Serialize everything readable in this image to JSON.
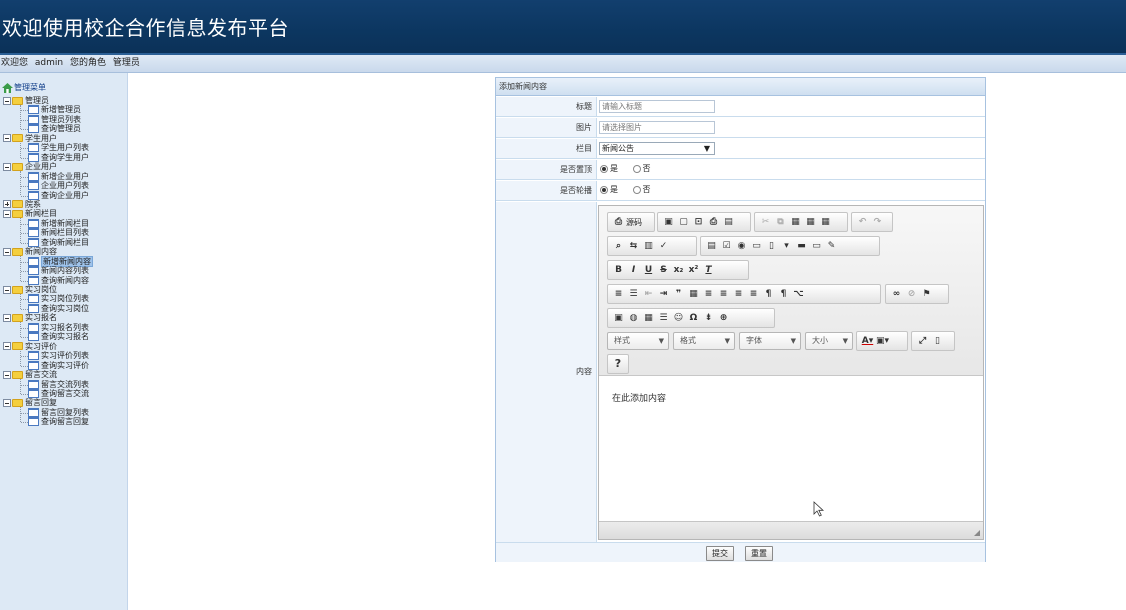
{
  "header": {
    "title": "欢迎使用校企合作信息发布平台"
  },
  "userbar": {
    "welcome": "欢迎您",
    "username": "admin",
    "role_label": "您的角色",
    "role": "管理员"
  },
  "sidebar": {
    "root": "管理菜单",
    "groups": [
      {
        "label": "管理员",
        "items": [
          "新增管理员",
          "管理员列表",
          "查询管理员"
        ]
      },
      {
        "label": "学生用户",
        "items": [
          "学生用户列表",
          "查询学生用户"
        ]
      },
      {
        "label": "企业用户",
        "items": [
          "新增企业用户",
          "企业用户列表",
          "查询企业用户"
        ]
      },
      {
        "label": "院系",
        "items": []
      },
      {
        "label": "新闻栏目",
        "items": [
          "新增新闻栏目",
          "新闻栏目列表",
          "查询新闻栏目"
        ]
      },
      {
        "label": "新闻内容",
        "items": [
          "新增新闻内容",
          "新闻内容列表",
          "查询新闻内容"
        ]
      },
      {
        "label": "实习岗位",
        "items": [
          "实习岗位列表",
          "查询实习岗位"
        ]
      },
      {
        "label": "实习报名",
        "items": [
          "实习报名列表",
          "查询实习报名"
        ]
      },
      {
        "label": "实习评价",
        "items": [
          "实习评价列表",
          "查询实习评价"
        ]
      },
      {
        "label": "留言交流",
        "items": [
          "留言交流列表",
          "查询留言交流"
        ]
      },
      {
        "label": "留言回复",
        "items": [
          "留言回复列表",
          "查询留言回复"
        ]
      }
    ],
    "selected": "新增新闻内容"
  },
  "form": {
    "panel_title": "添加新闻内容",
    "title_label": "标题",
    "title_placeholder": "请输入标题",
    "image_label": "图片",
    "image_placeholder": "请选择图片",
    "column_label": "栏目",
    "column_value": "新闻公告",
    "top_label": "是否置顶",
    "carousel_label": "是否轮播",
    "yes": "是",
    "no": "否",
    "content_label": "内容",
    "content_placeholder": "在此添加内容",
    "submit": "提交",
    "reset": "重置"
  },
  "editor": {
    "source_label": "源码",
    "combo_style": "样式",
    "combo_format": "格式",
    "combo_font": "字体",
    "combo_size": "大小",
    "help": "?"
  }
}
